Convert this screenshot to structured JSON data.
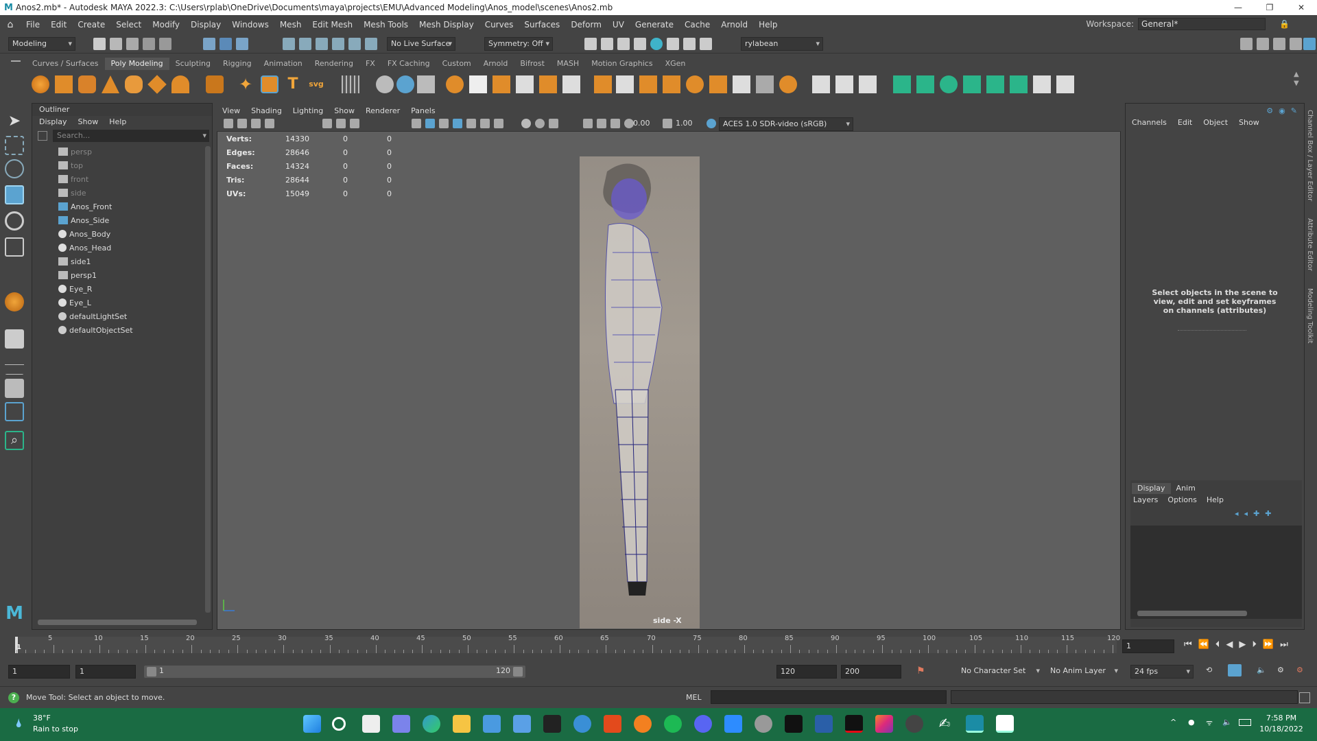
{
  "window": {
    "title": "Anos2.mb* - Autodesk MAYA 2022.3: C:\\Users\\rplab\\OneDrive\\Documents\\maya\\projects\\EMU\\Advanced Modeling\\Anos_model\\scenes\\Anos2.mb",
    "logo": "M",
    "min": "—",
    "max": "❐",
    "close": "✕"
  },
  "menubar": {
    "items": [
      "File",
      "Edit",
      "Create",
      "Select",
      "Modify",
      "Display",
      "Windows",
      "Mesh",
      "Edit Mesh",
      "Mesh Tools",
      "Mesh Display",
      "Curves",
      "Surfaces",
      "Deform",
      "UV",
      "Generate",
      "Cache",
      "Arnold",
      "Help"
    ],
    "workspace_label": "Workspace:",
    "workspace_value": "General*"
  },
  "toolbar": {
    "menuset": "Modeling",
    "live_surface": "No Live Surface",
    "symmetry": "Symmetry: Off",
    "user": "rylabean"
  },
  "shelf": {
    "tabs": [
      "Curves / Surfaces",
      "Poly Modeling",
      "Sculpting",
      "Rigging",
      "Animation",
      "Rendering",
      "FX",
      "FX Caching",
      "Custom",
      "Arnold",
      "Bifrost",
      "MASH",
      "Motion Graphics",
      "XGen"
    ],
    "active_tab": "Poly Modeling",
    "text_icons": {
      "type": "T",
      "svg": "svg"
    }
  },
  "outliner": {
    "title": "Outliner",
    "menu": [
      "Display",
      "Show",
      "Help"
    ],
    "search_placeholder": "Search...",
    "items": [
      {
        "label": "persp",
        "icon": "camera-icon",
        "dim": true
      },
      {
        "label": "top",
        "icon": "camera-icon",
        "dim": true
      },
      {
        "label": "front",
        "icon": "camera-icon",
        "dim": true
      },
      {
        "label": "side",
        "icon": "camera-icon",
        "dim": true
      },
      {
        "label": "Anos_Front",
        "icon": "image-plane-icon",
        "dim": false
      },
      {
        "label": "Anos_Side",
        "icon": "image-plane-icon",
        "dim": false
      },
      {
        "label": "Anos_Body",
        "icon": "mesh-icon",
        "dim": false
      },
      {
        "label": "Anos_Head",
        "icon": "mesh-icon",
        "dim": false
      },
      {
        "label": "side1",
        "icon": "camera-icon",
        "dim": false
      },
      {
        "label": "persp1",
        "icon": "camera-icon",
        "dim": false
      },
      {
        "label": "Eye_R",
        "icon": "mesh-icon",
        "dim": false
      },
      {
        "label": "Eye_L",
        "icon": "mesh-icon",
        "dim": false
      },
      {
        "label": "defaultLightSet",
        "icon": "set-icon",
        "dim": false
      },
      {
        "label": "defaultObjectSet",
        "icon": "set-icon",
        "dim": false
      }
    ]
  },
  "viewport": {
    "menu": [
      "View",
      "Shading",
      "Lighting",
      "Show",
      "Renderer",
      "Panels"
    ],
    "exposure": "0.00",
    "gamma": "1.00",
    "colorspace": "ACES 1.0 SDR-video (sRGB)",
    "label": "side -X",
    "hud": [
      {
        "k": "Verts:",
        "v": "14330",
        "a": "0",
        "b": "0"
      },
      {
        "k": "Edges:",
        "v": "28646",
        "a": "0",
        "b": "0"
      },
      {
        "k": "Faces:",
        "v": "14324",
        "a": "0",
        "b": "0"
      },
      {
        "k": "Tris:",
        "v": "28644",
        "a": "0",
        "b": "0"
      },
      {
        "k": "UVs:",
        "v": "15049",
        "a": "0",
        "b": "0"
      }
    ]
  },
  "channelbox": {
    "menu": [
      "Channels",
      "Edit",
      "Object",
      "Show"
    ],
    "message": "Select objects in the scene to view, edit and set keyframes on channels (attributes)",
    "side_tabs": [
      "Channel Box / Layer Editor",
      "Attribute Editor",
      "Modeling Toolkit"
    ]
  },
  "layers": {
    "tabs": [
      "Display",
      "Anim"
    ],
    "active": "Display",
    "menu": [
      "Layers",
      "Options",
      "Help"
    ]
  },
  "timeline": {
    "ticks": [
      "5",
      "10",
      "15",
      "20",
      "25",
      "30",
      "35",
      "40",
      "45",
      "50",
      "55",
      "60",
      "65",
      "70",
      "75",
      "80",
      "85",
      "90",
      "95",
      "100",
      "105",
      "110",
      "115",
      "120"
    ],
    "first": "1",
    "current": "1"
  },
  "range": {
    "start": "1",
    "inner_start": "1",
    "slider_start": "1",
    "slider_end": "120",
    "end": "120",
    "max": "200",
    "character_set": "No Character Set",
    "anim_layer": "No Anim Layer",
    "fps": "24 fps"
  },
  "status": {
    "help": "Move Tool: Select an object to move.",
    "lang": "MEL"
  },
  "taskbar": {
    "weather_temp": "38°F",
    "weather_desc": "Rain to stop",
    "time": "7:58 PM",
    "date": "10/18/2022"
  }
}
